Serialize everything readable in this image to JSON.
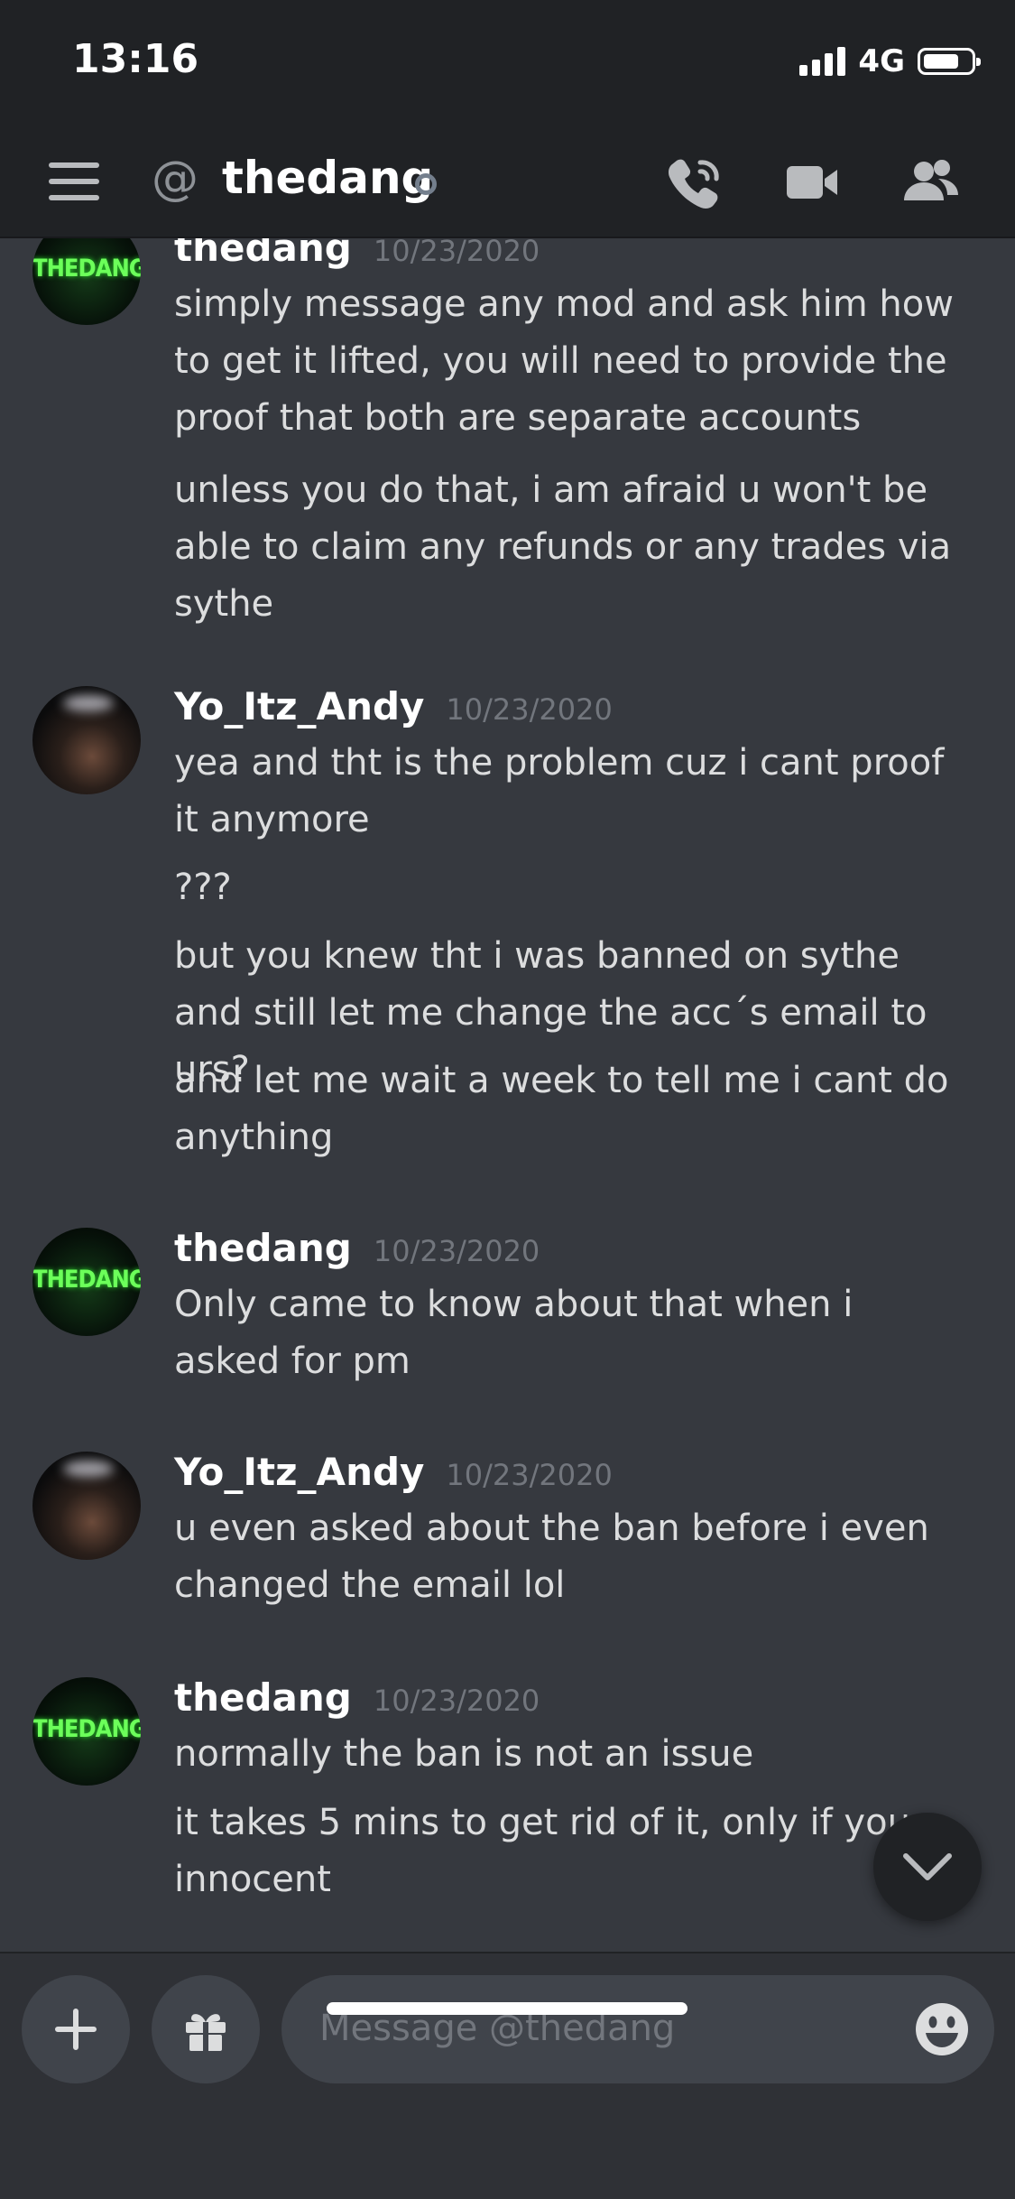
{
  "status_bar": {
    "time": "13:16",
    "network": "4G",
    "battery_level": 0.75
  },
  "header": {
    "at_symbol": "@",
    "channel_name": "thedang",
    "icons": [
      "menu-icon",
      "call-icon",
      "video-icon",
      "members-icon"
    ]
  },
  "messages": [
    {
      "author": "thedang",
      "timestamp": "10/23/2020",
      "avatar_text": "THEDANG",
      "lines": [
        "simply message any mod and ask him how to get it lifted, you will need to provide the proof that both are separate accounts",
        "unless you do that, i am afraid u won't be able to claim any refunds or any trades via sythe"
      ]
    },
    {
      "author": "Yo_Itz_Andy",
      "timestamp": "10/23/2020",
      "lines": [
        "yea and tht is the problem cuz i cant proof it anymore",
        "???",
        "but you knew tht i was banned on sythe and still let me change the acc´s email to urs?",
        "and let me wait a week to tell me i cant do anything"
      ]
    },
    {
      "author": "thedang",
      "timestamp": "10/23/2020",
      "avatar_text": "THEDANG",
      "lines": [
        "Only came to know about that when i asked for pm"
      ]
    },
    {
      "author": "Yo_Itz_Andy",
      "timestamp": "10/23/2020",
      "lines": [
        "u even asked about the ban before i even changed the email lol"
      ]
    },
    {
      "author": "thedang",
      "timestamp": "10/23/2020",
      "avatar_text": "THEDANG",
      "lines": [
        "normally the ban is not an issue",
        "it takes 5 mins to get rid of it, only if you innocent"
      ]
    }
  ],
  "composer": {
    "placeholder": "Message @thedang"
  },
  "colors": {
    "background": "#36393f",
    "header": "#202225",
    "composer": "#2f3136",
    "input": "#40444b"
  }
}
